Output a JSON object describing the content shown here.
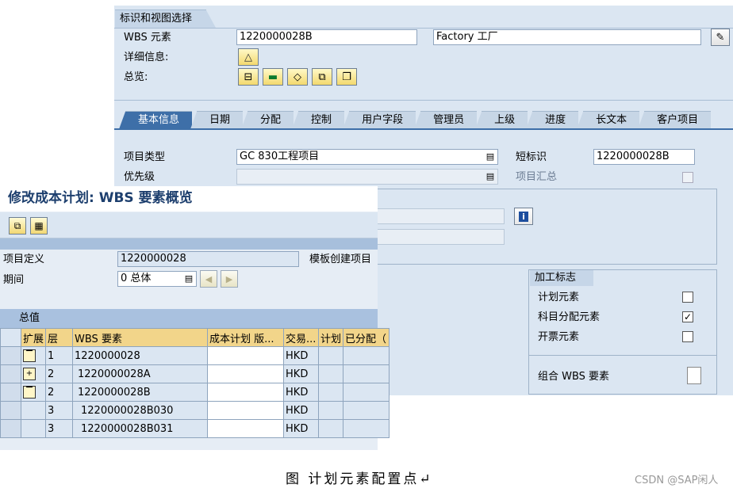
{
  "back_window": {
    "section_title": "标识和视图选择",
    "wbs_label": "WBS 元素",
    "wbs_value": "1220000028B",
    "wbs_desc": "Factory 工厂",
    "detail_label": "详细信息:",
    "overview_label": "总览:",
    "tabs": [
      {
        "label": "基本信息",
        "active": true
      },
      {
        "label": "日期"
      },
      {
        "label": "分配"
      },
      {
        "label": "控制"
      },
      {
        "label": "用户字段"
      },
      {
        "label": "管理员"
      },
      {
        "label": "上级"
      },
      {
        "label": "进度"
      },
      {
        "label": "长文本"
      },
      {
        "label": "客户项目"
      }
    ],
    "project_type_label": "项目类型",
    "project_type_value": "GC 830工程项目",
    "short_id_label": "短标识",
    "short_id_value": "1220000028B",
    "priority_label": "优先级",
    "project_summary_label": "项目汇总",
    "process_flags_title": "加工标志",
    "flags": [
      {
        "label": "计划元素",
        "checked": false
      },
      {
        "label": "科目分配元素",
        "checked": true
      },
      {
        "label": "开票元素",
        "checked": false
      }
    ],
    "grouping_wbs_label": "组合 WBS 要素"
  },
  "front_window": {
    "title": "修改成本计划: WBS 要素概览",
    "project_def_label": "项目定义",
    "project_def_value": "1220000028",
    "template_label": "模板创建项目",
    "period_label": "期间",
    "period_value": "0 总体",
    "totals_label": "总值",
    "columns": [
      "扩展",
      "层",
      "WBS 要素",
      "成本计划 版...",
      "交易...",
      "计划",
      "已分配（"
    ],
    "rows": [
      {
        "level": "1",
        "wbs": "1220000028",
        "currency": "HKD",
        "icon": "collapse-icon"
      },
      {
        "level": "2",
        "wbs": "1220000028A",
        "currency": "HKD",
        "icon": "expand-icon"
      },
      {
        "level": "2",
        "wbs": "1220000028B",
        "currency": "HKD",
        "icon": "collapse-icon"
      },
      {
        "level": "3",
        "wbs": "1220000028B030",
        "currency": "HKD",
        "icon": ""
      },
      {
        "level": "3",
        "wbs": "1220000028B031",
        "currency": "HKD",
        "icon": ""
      }
    ]
  },
  "caption": "图 计划元素配置点↵",
  "watermark": "CSDN @SAP闲人"
}
